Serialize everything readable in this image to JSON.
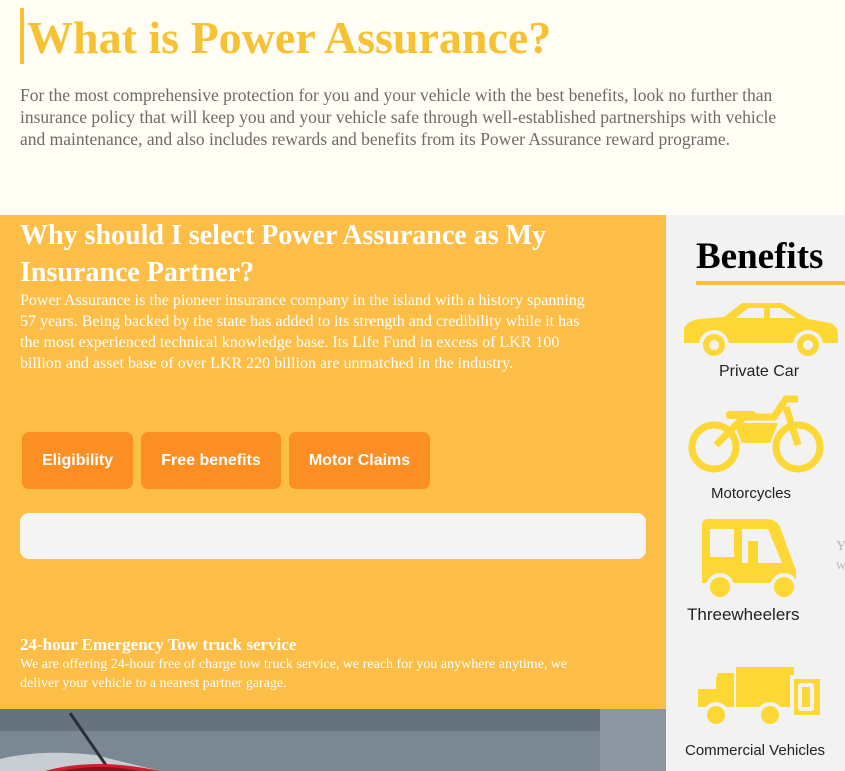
{
  "intro": {
    "title": "What is Power Assurance?",
    "lines": [
      "For the most comprehensive protection for you and your vehicle with the best benefits, look no further than",
      "insurance policy that will keep you and your vehicle safe through well-established partnerships with vehicle",
      "and maintenance, and also includes rewards and benefits from its Power Assurance reward programe."
    ]
  },
  "why": {
    "title_lines": [
      "Why should I select Power Assurance as My",
      "Insurance Partner?"
    ],
    "text_lines": [
      "Power Assurance is the pioneer insurance company in the island with a history spanning",
      "57 years. Being backed by the state has added to its strength and credibility while it has",
      "the most experienced technical knowledge base. Its Life Fund in excess of LKR 100",
      "billion and asset base of over LKR 220 billion are unmatched in the industry."
    ]
  },
  "tabs": [
    {
      "label": "Eligibility"
    },
    {
      "label": "Free benefits"
    },
    {
      "label": "Motor Claims"
    }
  ],
  "tow": {
    "title": "24-hour Emergency Tow truck service",
    "lines": [
      "We are offering 24-hour free of charge tow truck service, we reach for you anywhere anytime, we",
      "deliver your vehicle to a nearest partner garage."
    ]
  },
  "benefits": {
    "title": "Benefits",
    "items": [
      {
        "label": "Private Car",
        "icon": "car-icon"
      },
      {
        "label": "Motorcycles",
        "icon": "motorcycle-icon"
      },
      {
        "label": "Threewheelers",
        "icon": "three-wheeler-icon"
      },
      {
        "label": "Commercial Vehicles",
        "icon": "truck-icon"
      }
    ],
    "peek_lines": [
      "Y",
      "w"
    ]
  },
  "colors": {
    "accent": "#f7c134",
    "panel": "#fdbe47",
    "tab": "#fb8f23",
    "icon": "#fdd835"
  }
}
